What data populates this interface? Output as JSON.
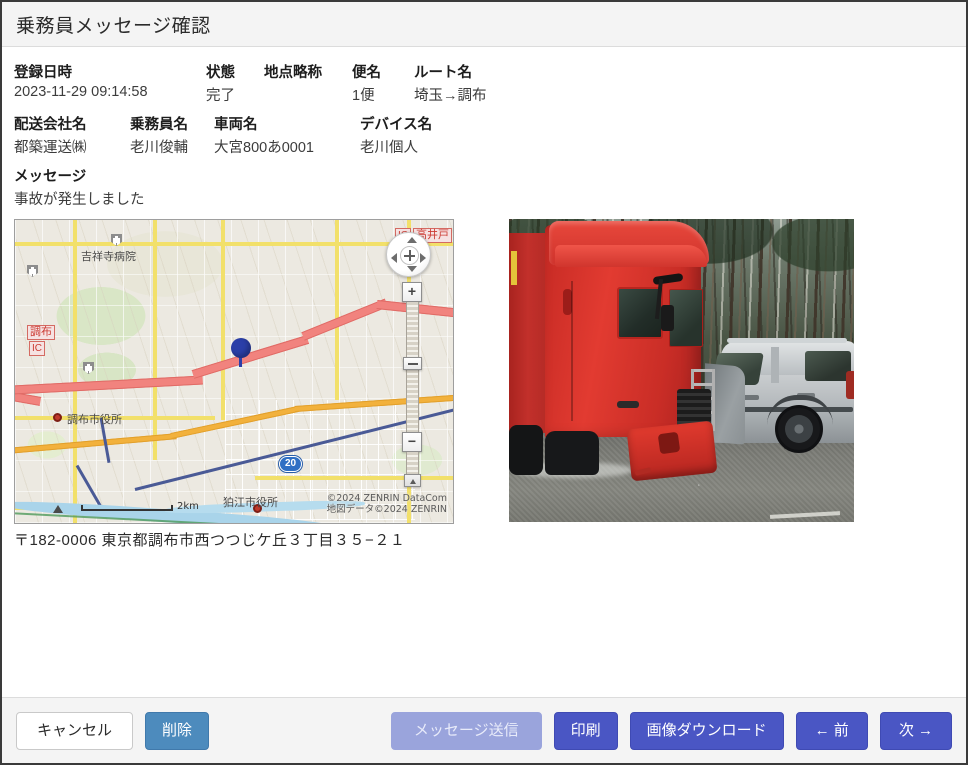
{
  "header": {
    "title": "乗務員メッセージ確認"
  },
  "details": {
    "row1": [
      {
        "label": "登録日時",
        "value": "2023-11-29 09:14:58"
      },
      {
        "label": "状態",
        "value": "完了"
      },
      {
        "label": "地点略称",
        "value": ""
      },
      {
        "label": "便名",
        "value": "1便"
      },
      {
        "label": "ルート名",
        "value": "埼玉→調布"
      }
    ],
    "row2": [
      {
        "label": "配送会社名",
        "value": "都築運送㈱"
      },
      {
        "label": "乗務員名",
        "value": "老川俊輔"
      },
      {
        "label": "車両名",
        "value": "大宮800あ0001"
      },
      {
        "label": "デバイス名",
        "value": "老川個人"
      }
    ],
    "message": {
      "label": "メッセージ",
      "value": "事故が発生しました"
    }
  },
  "map": {
    "address": "〒182-0006 東京都調布市西つつじケ丘３丁目３５−２１",
    "pois": [
      {
        "name": "吉祥寺病院"
      },
      {
        "name": "調布市役所"
      },
      {
        "name": "狛江市役所"
      }
    ],
    "ic_labels": [
      {
        "name": "調布"
      },
      {
        "name": "IC"
      },
      {
        "name": "IC"
      },
      {
        "name": "高井戸"
      }
    ],
    "route_shield": "20",
    "scale": "2km",
    "credit_line1": "©2024 ZENRIN DataCom",
    "credit_line2": "地図データ©2024 ZENRIN",
    "zoom_in_label": "+",
    "zoom_out_label": "−"
  },
  "footer": {
    "cancel": "キャンセル",
    "delete": "削除",
    "send_message": "メッセージ送信",
    "print": "印刷",
    "download_image": "画像ダウンロード",
    "prev": "前",
    "next": "次",
    "prev_arrow": "←",
    "next_arrow": "→"
  },
  "colors": {
    "primary": "#4a56c4",
    "delete": "#4d8bbd",
    "disabled": "#9aa4dc",
    "header_bg": "#f4f4f4"
  }
}
